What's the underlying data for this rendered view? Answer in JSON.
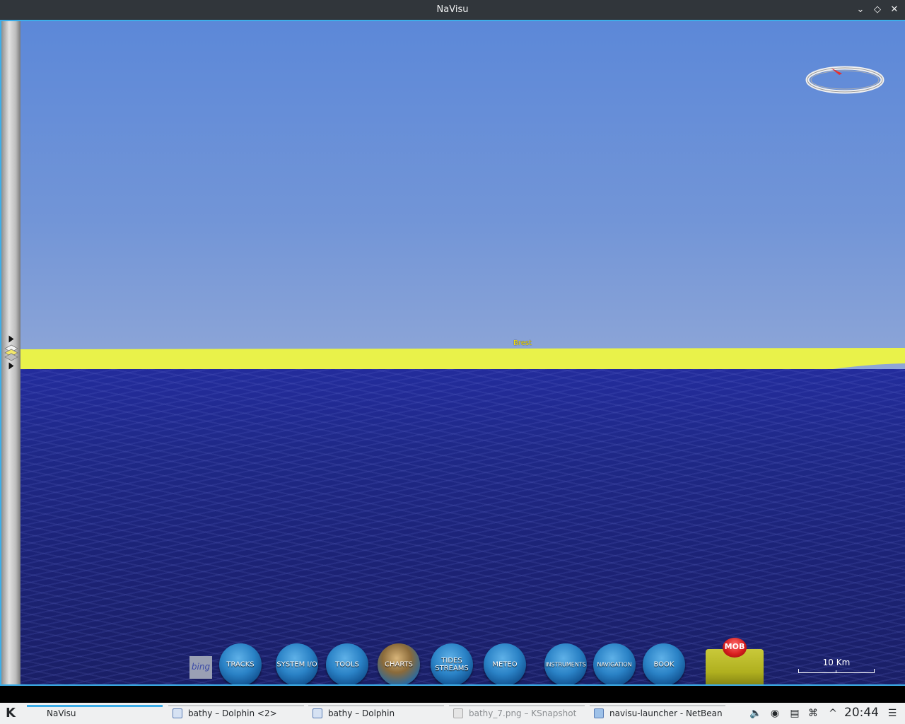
{
  "window": {
    "title": "NaVisu"
  },
  "map": {
    "place_label": "Brest",
    "scale_label": "10 Km",
    "attribution": "bing"
  },
  "toolbar": {
    "buttons": [
      {
        "label": "TRACKS"
      },
      {
        "label": "SYSTEM I/O"
      },
      {
        "label": "TOOLS"
      },
      {
        "label": "CHARTS"
      },
      {
        "label": "TIDES STREAMS"
      },
      {
        "label": "METEO"
      },
      {
        "label": "INSTRUMENTS"
      },
      {
        "label": "NAVIGATION"
      },
      {
        "label": "BOOK"
      }
    ],
    "mob_label": "MOB"
  },
  "taskbar": {
    "tasks": [
      {
        "label": "NaVisu"
      },
      {
        "label": "bathy – Dolphin <2>"
      },
      {
        "label": "bathy – Dolphin"
      },
      {
        "label": "bathy_7.png – KSnapshot"
      },
      {
        "label": "navisu-launcher - NetBeans I"
      }
    ],
    "clock": "20:44"
  },
  "icons": [
    "kde-menu-icon",
    "volume-icon",
    "steam-icon",
    "clipboard-icon",
    "wifi-icon",
    "expand-tray-icon",
    "hamburger-icon",
    "compass-icon",
    "layers-icon"
  ]
}
